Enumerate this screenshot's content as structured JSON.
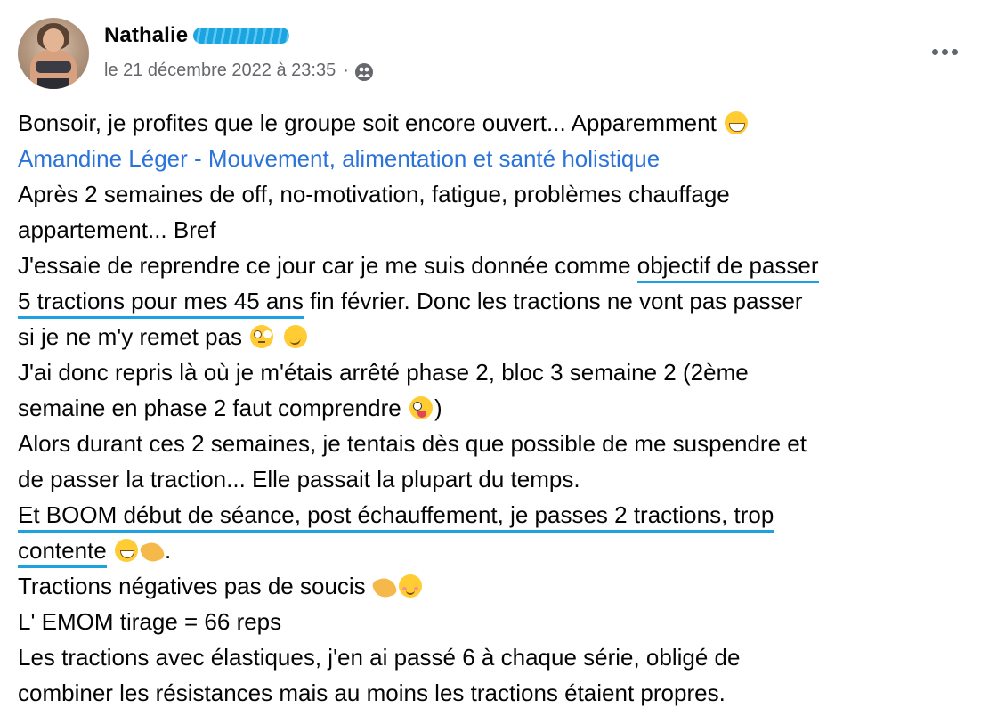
{
  "author": {
    "name": "Nathalie",
    "timestamp": "le 21 décembre 2022 à 23:35",
    "separator": "·",
    "audience_icon": "group-icon"
  },
  "more_icon": "more-options-icon",
  "post": {
    "l1": "Bonsoir, je profites que le groupe soit encore ouvert... Apparemment",
    "l2_link": "Amandine Léger - Mouvement, alimentation et santé holistique",
    "l3": "Après 2 semaines de off, no-motivation, fatigue, problèmes chauffage",
    "l4": "appartement... Bref",
    "l5a": "J'essaie de reprendre ce jour car je me suis donnée comme ",
    "l5b": "objectif de passer",
    "l6a": "5 tractions pour mes 45 ans",
    "l6b": " fin février. Donc les tractions ne vont pas passer",
    "l7": "si je ne m'y remet pas",
    "l8": "J'ai donc repris là où je m'étais arrêté phase 2, bloc 3 semaine 2 (2ème",
    "l9a": "semaine en phase 2 faut comprendre",
    "l9b": ")",
    "l10": "Alors durant ces 2 semaines, je tentais dès que possible de me suspendre et",
    "l11": "de passer la traction... Elle passait la plupart du temps.",
    "l12": "Et BOOM début de séance, post échauffement, je passes 2 tractions, trop",
    "l13a": "contente",
    "l13b": ".",
    "l14": "Tractions négatives pas de soucis",
    "l15": "L' EMOM tirage = 66 reps",
    "l16": "Les tractions avec élastiques, j'en ai passé 6 à chaque série, obligé de",
    "l17": "combiner les résistances mais au moins les tractions étaient propres."
  },
  "colors": {
    "link": "#2a73d9",
    "highlight_underline": "#1da1e0",
    "secondary_text": "#65676b"
  }
}
